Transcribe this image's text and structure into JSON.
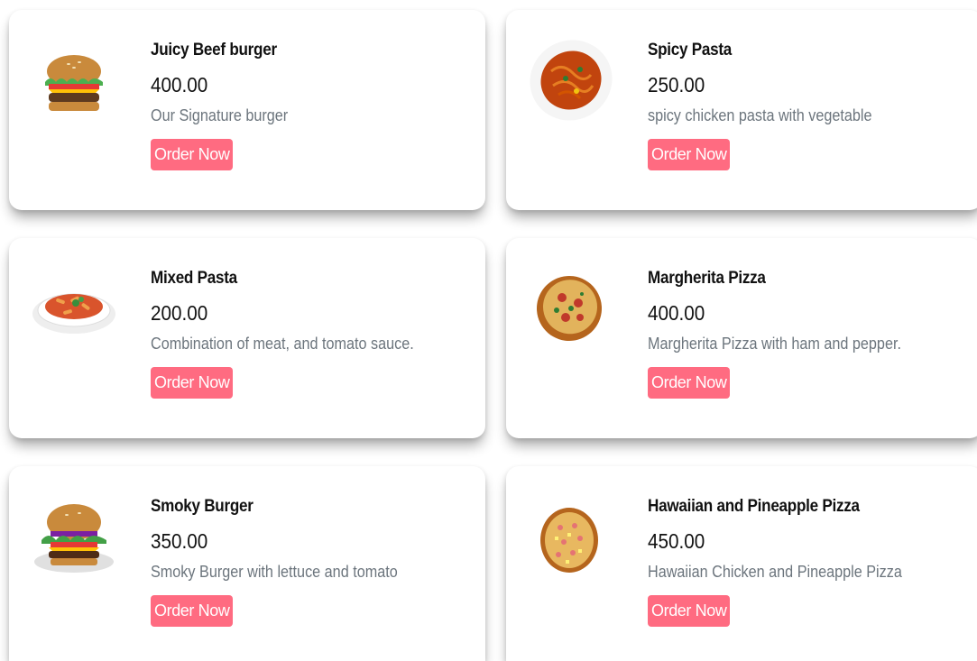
{
  "menu": {
    "items": [
      {
        "name": "Juicy Beef burger",
        "price": "400.00",
        "description": "Our Signature burger",
        "button_label": "Order Now",
        "icon": "burger-icon"
      },
      {
        "name": "Spicy Pasta",
        "price": "250.00",
        "description": "spicy chicken pasta with vegetable",
        "button_label": "Order Now",
        "icon": "pasta-icon"
      },
      {
        "name": "Mixed Pasta",
        "price": "200.00",
        "description": "Combination of meat, and tomato sauce.",
        "button_label": "Order Now",
        "icon": "pasta-bowl-icon"
      },
      {
        "name": "Margherita Pizza",
        "price": "400.00",
        "description": "Margherita Pizza with ham and pepper.",
        "button_label": "Order Now",
        "icon": "pizza-icon"
      },
      {
        "name": "Smoky Burger",
        "price": "350.00",
        "description": "Smoky Burger with lettuce and tomato",
        "button_label": "Order Now",
        "icon": "burger-icon"
      },
      {
        "name": "Hawaiian and Pineapple Pizza",
        "price": "450.00",
        "description": "Hawaiian Chicken and Pineapple Pizza",
        "button_label": "Order Now",
        "icon": "pizza-icon"
      }
    ]
  },
  "colors": {
    "button_bg": "#ff6b81",
    "price_text": "#111111",
    "description_text": "#6c757d"
  }
}
